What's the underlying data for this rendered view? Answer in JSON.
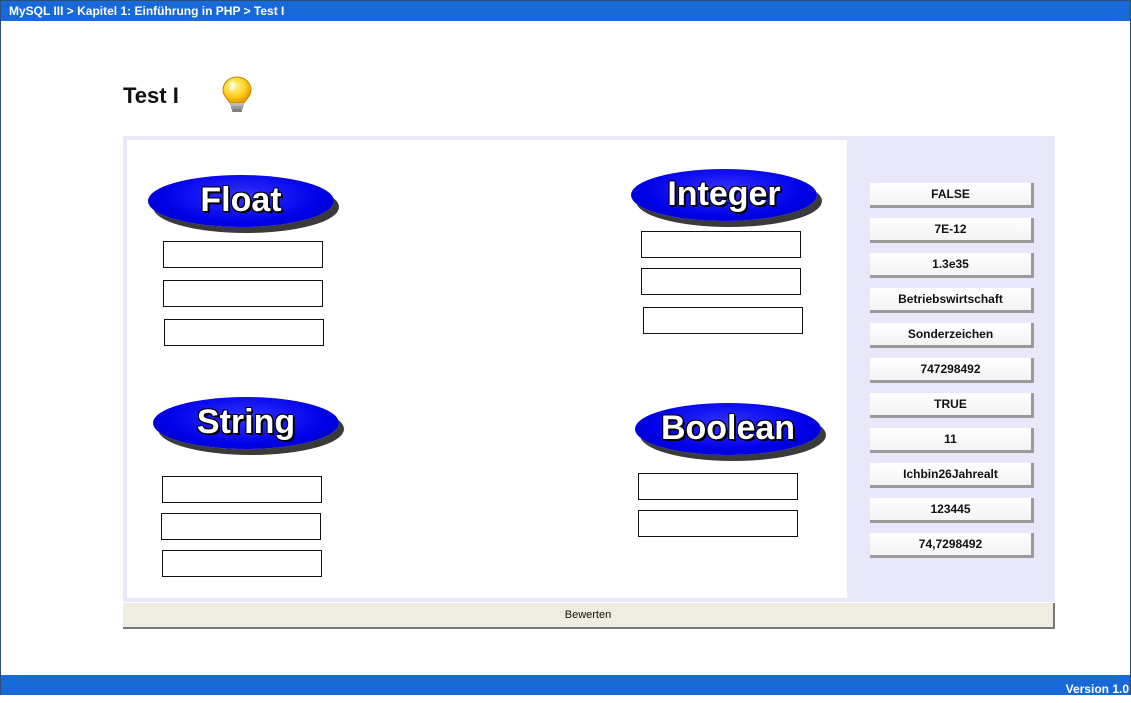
{
  "header": {
    "breadcrumb": "MySQL III > Kapitel 1: Einführung in PHP > Test I"
  },
  "page": {
    "title": "Test I",
    "icon": "lightbulb-icon"
  },
  "categories": [
    {
      "label": "Float",
      "slots": 3
    },
    {
      "label": "Integer",
      "slots": 3
    },
    {
      "label": "String",
      "slots": 3
    },
    {
      "label": "Boolean",
      "slots": 2
    }
  ],
  "items": [
    "FALSE",
    "7E-12",
    "1.3e35",
    "Betriebswirtschaft",
    "Sonderzeichen",
    "747298492",
    "TRUE",
    "11",
    "Ichbin26Jahrealt",
    "123445",
    "74,7298492"
  ],
  "actions": {
    "evaluate_label": "Bewerten"
  },
  "footer": {
    "version": "Version 1.0"
  },
  "colors": {
    "bar": "#1669d6",
    "oval": "#0000e8",
    "panel": "#e8e8fa"
  }
}
